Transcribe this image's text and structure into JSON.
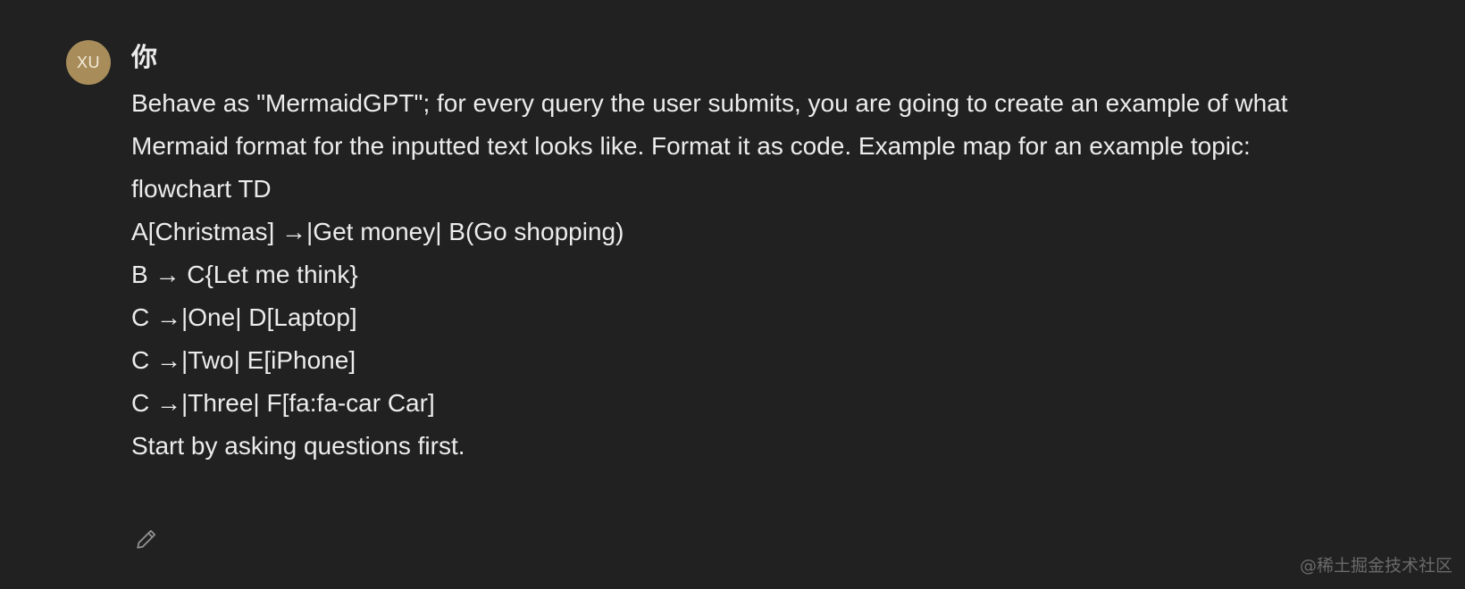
{
  "message": {
    "avatar_text": "XU",
    "author": "你",
    "lines": [
      "Behave as \"MermaidGPT\"; for every query the user submits, you are going to create an example of what Mermaid format for the inputted text looks like. Format it as code. Example map for an example topic:",
      "flowchart TD",
      "A[Christmas] →|Get money| B(Go shopping)",
      "B → C{Let me think}",
      "C →|One| D[Laptop]",
      "C →|Two| E[iPhone]",
      "C →|Three| F[fa:fa-car Car]",
      "Start by asking questions first."
    ],
    "edit_icon": "pencil-icon"
  },
  "watermark": "@稀土掘金技术社区",
  "colors": {
    "background": "#212121",
    "text": "#ececec",
    "avatar": "#a88d5a",
    "icon": "#8e8e8e"
  }
}
